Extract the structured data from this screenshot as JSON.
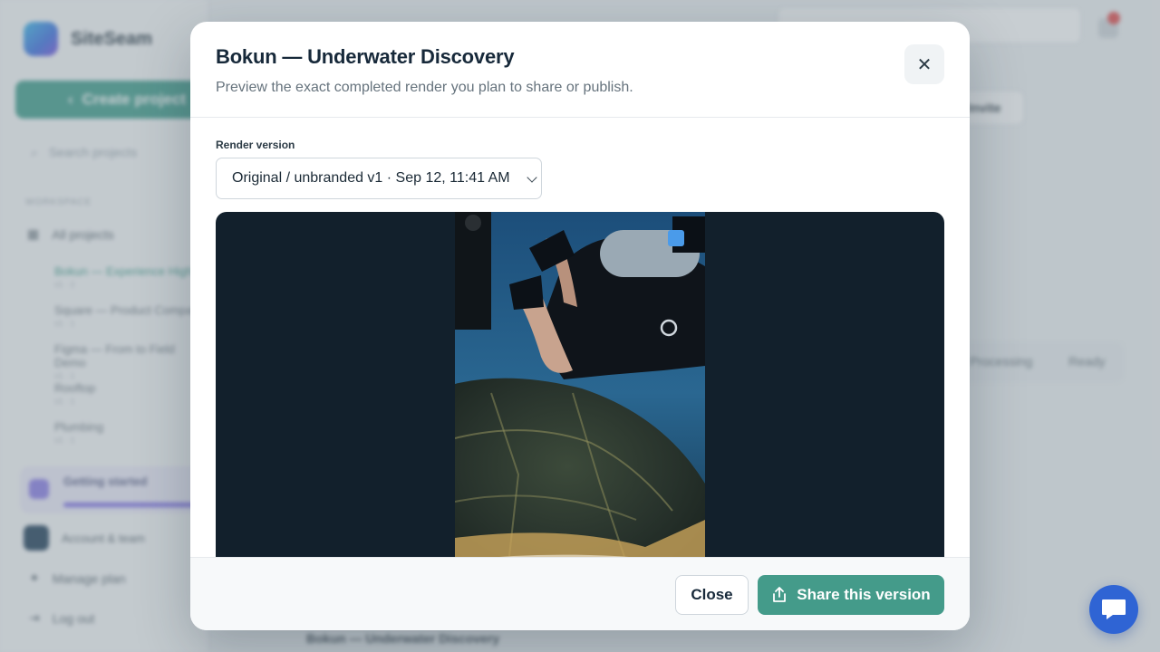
{
  "background": {
    "brand_name": "SiteSeam",
    "create_button": "Create project",
    "search_placeholder": "Search projects",
    "section_label": "WORKSPACE",
    "all_projects": "All projects",
    "projects": [
      {
        "name": "Bokun — Experience Highlig",
        "meta": "v1 · 2",
        "active": true
      },
      {
        "name": "Square — Product Compari",
        "meta": "v1 · 1"
      },
      {
        "name": "Figma — From to Field Demo",
        "meta": "v1 · 1"
      },
      {
        "name": "Rooftop",
        "meta": "v1 · 1"
      },
      {
        "name": "Plumbing",
        "meta": "v1 · 1"
      }
    ],
    "getting_started": "Getting started",
    "account": "Account & team",
    "manage_plan": "Manage plan",
    "log_out": "Log out",
    "header_pill": "Invite",
    "filter_tabs": "Processing Ready",
    "card_title": "Bokun — Underwater Discovery"
  },
  "modal": {
    "title": "Bokun — Underwater Discovery",
    "subtitle": "Preview the exact completed render you plan to share or publish.",
    "close_icon": "close-icon",
    "render_label": "Render version",
    "render_selected": "Original / unbranded v1 · Sep 12, 11:41 AM",
    "close_button": "Close",
    "share_button": "Share this version",
    "share_icon": "share-icon"
  },
  "chat": {
    "icon": "chat-bubble-icon"
  },
  "colors": {
    "accent": "#449b8a",
    "preview_bg": "#12202c",
    "chat": "#2f64d4"
  }
}
